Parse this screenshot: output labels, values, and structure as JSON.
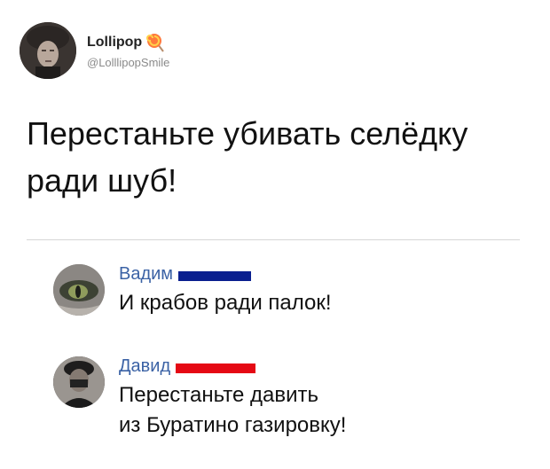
{
  "author": {
    "name": "Lollipop",
    "handle": "@LolllipopSmile",
    "emoji_icon": "lollipop-icon"
  },
  "tweet": {
    "text": "Перестаньте убивать селёдку\nради шуб!"
  },
  "comments": [
    {
      "name": "Вадим",
      "bar_color": "#0a1f8f",
      "text": "И крабов ради палок!"
    },
    {
      "name": "Давид",
      "bar_color": "#e50914",
      "text": "Перестаньте давить\nиз Буратино газировку!"
    }
  ],
  "colors": {
    "name_link": "#3b62a5",
    "divider": "#d6d6d6"
  }
}
